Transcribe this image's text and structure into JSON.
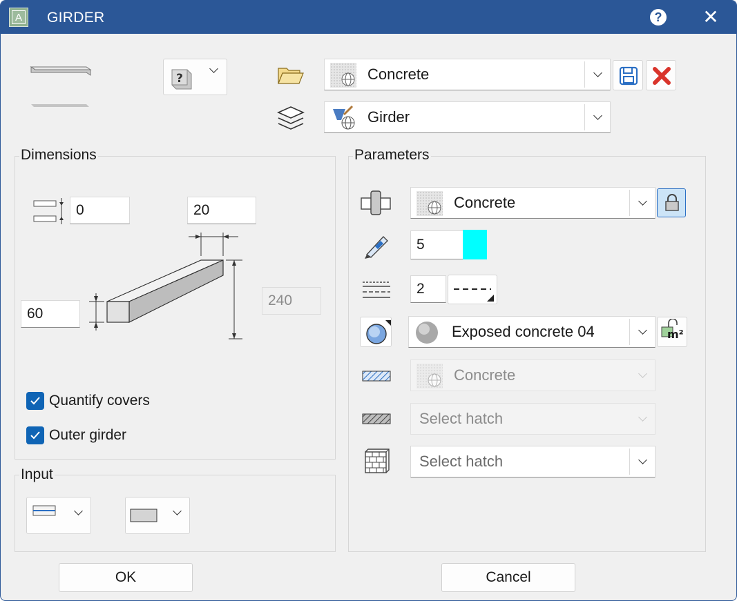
{
  "window": {
    "title": "GIRDER",
    "help_glyph": "?",
    "close_glyph": "✕"
  },
  "top": {
    "favorite_help_glyph": "?",
    "favorite_material": "Concrete",
    "layer": "Girder"
  },
  "dimensions": {
    "label": "Dimensions",
    "offset": "0",
    "width": "20",
    "height": "60",
    "length": "240",
    "quantify_covers_label": "Quantify covers",
    "quantify_covers_checked": true,
    "outer_girder_label": "Outer girder",
    "outer_girder_checked": true
  },
  "input": {
    "label": "Input"
  },
  "parameters": {
    "label": "Parameters",
    "material": "Concrete",
    "pen_value": "5",
    "pen_color": "#00ffff",
    "line_type_value": "2",
    "surface": "Exposed concrete 04",
    "hatch_material": "Concrete",
    "hatch_placeholder_1": "Select hatch",
    "hatch_placeholder_2": "Select hatch",
    "m2_label": "m²"
  },
  "buttons": {
    "ok": "OK",
    "cancel": "Cancel"
  },
  "colors": {
    "title_bar": "#2b5797",
    "checkbox": "#0f64b5",
    "delete_red": "#d9342b"
  }
}
